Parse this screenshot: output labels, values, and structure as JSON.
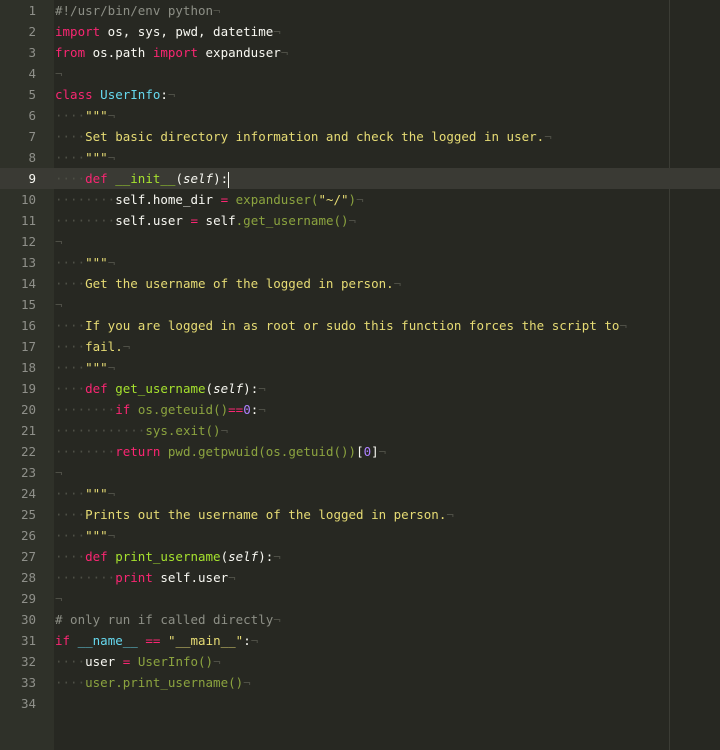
{
  "editor": {
    "active_line": 9,
    "lines": [
      {
        "n": "1",
        "tokens": [
          [
            "cmt",
            "#!/usr/bin/env python"
          ],
          [
            "ws",
            "¬"
          ]
        ]
      },
      {
        "n": "2",
        "tokens": [
          [
            "kw",
            "import"
          ],
          [
            "plain",
            " os, sys, pwd, datetime"
          ],
          [
            "ws",
            "¬"
          ]
        ]
      },
      {
        "n": "3",
        "tokens": [
          [
            "kw",
            "from"
          ],
          [
            "plain",
            " os.path "
          ],
          [
            "kw",
            "import"
          ],
          [
            "plain",
            " expanduser"
          ],
          [
            "ws",
            "¬"
          ]
        ]
      },
      {
        "n": "4",
        "tokens": [
          [
            "ws",
            "¬"
          ]
        ]
      },
      {
        "n": "5",
        "tokens": [
          [
            "kw",
            "class"
          ],
          [
            "plain",
            " "
          ],
          [
            "cls",
            "UserInfo"
          ],
          [
            "plain",
            ":"
          ],
          [
            "ws",
            "¬"
          ]
        ]
      },
      {
        "n": "6",
        "tokens": [
          [
            "ws",
            "····"
          ],
          [
            "str",
            "\"\"\""
          ],
          [
            "ws",
            "¬"
          ]
        ]
      },
      {
        "n": "7",
        "tokens": [
          [
            "ws",
            "····"
          ],
          [
            "str",
            "Set basic directory information and check the logged in user."
          ],
          [
            "ws",
            "¬"
          ]
        ]
      },
      {
        "n": "8",
        "tokens": [
          [
            "ws",
            "····"
          ],
          [
            "str",
            "\"\"\""
          ],
          [
            "ws",
            "¬"
          ]
        ]
      },
      {
        "n": "9",
        "tokens": [
          [
            "ws",
            "····"
          ],
          [
            "kw",
            "def"
          ],
          [
            "plain",
            " "
          ],
          [
            "fn",
            "__init__"
          ],
          [
            "plain",
            "("
          ],
          [
            "sp",
            "self"
          ],
          [
            "plain",
            "):"
          ],
          [
            "cursor",
            ""
          ]
        ]
      },
      {
        "n": "10",
        "tokens": [
          [
            "ws",
            "········"
          ],
          [
            "plain",
            "self.home_dir "
          ],
          [
            "sym",
            "="
          ],
          [
            "plain",
            " "
          ],
          [
            "call",
            "expanduser("
          ],
          [
            "str",
            "\"~/\""
          ],
          [
            "call",
            ")"
          ],
          [
            "ws",
            "¬"
          ]
        ]
      },
      {
        "n": "11",
        "tokens": [
          [
            "ws",
            "········"
          ],
          [
            "plain",
            "self.user "
          ],
          [
            "sym",
            "="
          ],
          [
            "plain",
            " self"
          ],
          [
            "call",
            ".get_username()"
          ],
          [
            "ws",
            "¬"
          ]
        ]
      },
      {
        "n": "12",
        "tokens": [
          [
            "ws",
            "¬"
          ]
        ]
      },
      {
        "n": "13",
        "tokens": [
          [
            "ws",
            "····"
          ],
          [
            "str",
            "\"\"\""
          ],
          [
            "ws",
            "¬"
          ]
        ]
      },
      {
        "n": "14",
        "tokens": [
          [
            "ws",
            "····"
          ],
          [
            "str",
            "Get the username of the logged in person."
          ],
          [
            "ws",
            "¬"
          ]
        ]
      },
      {
        "n": "15",
        "tokens": [
          [
            "ws",
            "¬"
          ]
        ]
      },
      {
        "n": "16",
        "tokens": [
          [
            "ws",
            "····"
          ],
          [
            "str",
            "If you are logged in as root or sudo this function forces the script to"
          ],
          [
            "ws",
            "¬"
          ]
        ]
      },
      {
        "n": "17",
        "tokens": [
          [
            "ws",
            "····"
          ],
          [
            "str",
            "fail."
          ],
          [
            "ws",
            "¬"
          ]
        ]
      },
      {
        "n": "18",
        "tokens": [
          [
            "ws",
            "····"
          ],
          [
            "str",
            "\"\"\""
          ],
          [
            "ws",
            "¬"
          ]
        ]
      },
      {
        "n": "19",
        "tokens": [
          [
            "ws",
            "····"
          ],
          [
            "kw",
            "def"
          ],
          [
            "plain",
            " "
          ],
          [
            "fn",
            "get_username"
          ],
          [
            "plain",
            "("
          ],
          [
            "sp",
            "self"
          ],
          [
            "plain",
            "):"
          ],
          [
            "ws",
            "¬"
          ]
        ]
      },
      {
        "n": "20",
        "tokens": [
          [
            "ws",
            "········"
          ],
          [
            "kw",
            "if"
          ],
          [
            "plain",
            " "
          ],
          [
            "call",
            "os.geteuid()"
          ],
          [
            "sym",
            "=="
          ],
          [
            "num",
            "0"
          ],
          [
            "plain",
            ":"
          ],
          [
            "ws",
            "¬"
          ]
        ]
      },
      {
        "n": "21",
        "tokens": [
          [
            "ws",
            "············"
          ],
          [
            "call",
            "sys.exit()"
          ],
          [
            "ws",
            "¬"
          ]
        ]
      },
      {
        "n": "22",
        "tokens": [
          [
            "ws",
            "········"
          ],
          [
            "kw",
            "return"
          ],
          [
            "plain",
            " "
          ],
          [
            "call",
            "pwd.getpwuid(os.getuid())"
          ],
          [
            "plain",
            "["
          ],
          [
            "num",
            "0"
          ],
          [
            "plain",
            "]"
          ],
          [
            "ws",
            "¬"
          ]
        ]
      },
      {
        "n": "23",
        "tokens": [
          [
            "ws",
            "¬"
          ]
        ]
      },
      {
        "n": "24",
        "tokens": [
          [
            "ws",
            "····"
          ],
          [
            "str",
            "\"\"\""
          ],
          [
            "ws",
            "¬"
          ]
        ]
      },
      {
        "n": "25",
        "tokens": [
          [
            "ws",
            "····"
          ],
          [
            "str",
            "Prints out the username of the logged in person."
          ],
          [
            "ws",
            "¬"
          ]
        ]
      },
      {
        "n": "26",
        "tokens": [
          [
            "ws",
            "····"
          ],
          [
            "str",
            "\"\"\""
          ],
          [
            "ws",
            "¬"
          ]
        ]
      },
      {
        "n": "27",
        "tokens": [
          [
            "ws",
            "····"
          ],
          [
            "kw",
            "def"
          ],
          [
            "plain",
            " "
          ],
          [
            "fn",
            "print_username"
          ],
          [
            "plain",
            "("
          ],
          [
            "sp",
            "self"
          ],
          [
            "plain",
            "):"
          ],
          [
            "ws",
            "¬"
          ]
        ]
      },
      {
        "n": "28",
        "tokens": [
          [
            "ws",
            "········"
          ],
          [
            "kw",
            "print"
          ],
          [
            "plain",
            " self.user"
          ],
          [
            "ws",
            "¬"
          ]
        ]
      },
      {
        "n": "29",
        "tokens": [
          [
            "ws",
            "¬"
          ]
        ]
      },
      {
        "n": "30",
        "tokens": [
          [
            "cmt",
            "# only run if called directly"
          ],
          [
            "ws",
            "¬"
          ]
        ]
      },
      {
        "n": "31",
        "tokens": [
          [
            "kw",
            "if"
          ],
          [
            "plain",
            " "
          ],
          [
            "cls",
            "__name__"
          ],
          [
            "plain",
            " "
          ],
          [
            "sym",
            "=="
          ],
          [
            "plain",
            " "
          ],
          [
            "str",
            "\"__main__\""
          ],
          [
            "plain",
            ":"
          ],
          [
            "ws",
            "¬"
          ]
        ]
      },
      {
        "n": "32",
        "tokens": [
          [
            "ws",
            "····"
          ],
          [
            "plain",
            "user "
          ],
          [
            "sym",
            "="
          ],
          [
            "plain",
            " "
          ],
          [
            "call",
            "UserInfo()"
          ],
          [
            "ws",
            "¬"
          ]
        ]
      },
      {
        "n": "33",
        "tokens": [
          [
            "ws",
            "····"
          ],
          [
            "call",
            "user.print_username()"
          ],
          [
            "ws",
            "¬"
          ]
        ]
      },
      {
        "n": "34",
        "tokens": []
      }
    ]
  }
}
